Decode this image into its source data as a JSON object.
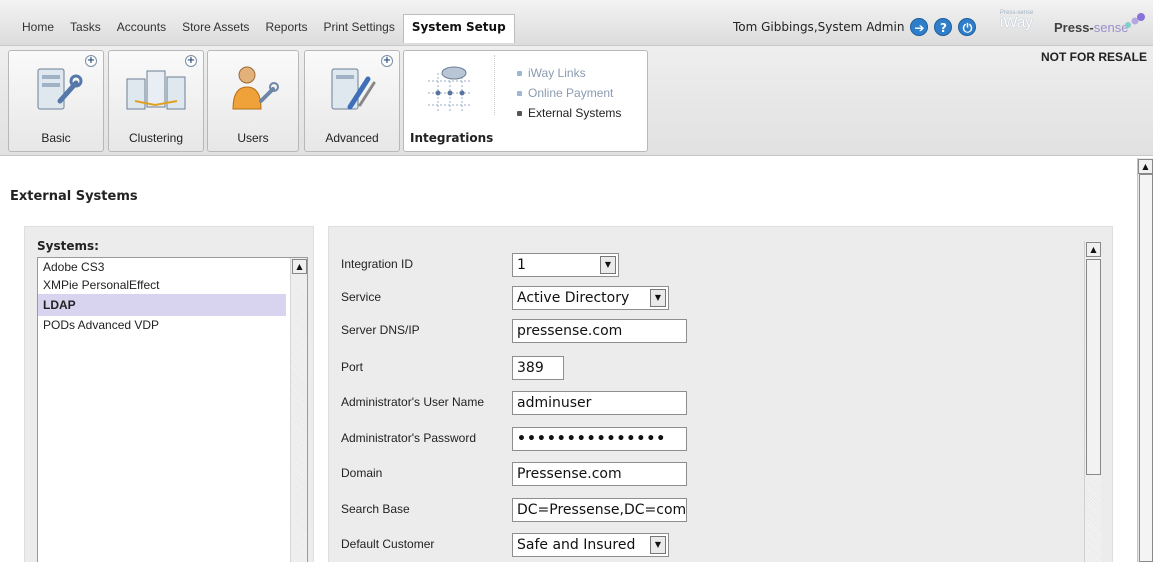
{
  "nav": {
    "items": [
      "Home",
      "Tasks",
      "Accounts",
      "Store Assets",
      "Reports",
      "Print Settings"
    ],
    "active": "System Setup"
  },
  "user": {
    "name": "Tom Gibbings,System Admin",
    "icons": [
      "logout-arrow-icon",
      "help-icon",
      "power-icon"
    ]
  },
  "brand": {
    "iway_small": "Press-sense",
    "iway": "iWay",
    "press": "Press",
    "sense": "sense",
    "not_for_resale": "NOT FOR RESALE",
    "accent_color": "#9c8fcc"
  },
  "ribbon": {
    "buttons": [
      {
        "label": "Basic",
        "icon": "server-wrench-icon"
      },
      {
        "label": "Clustering",
        "icon": "server-cluster-icon"
      },
      {
        "label": "Users",
        "icon": "user-wrench-icon"
      },
      {
        "label": "Advanced",
        "icon": "server-tools-icon"
      }
    ],
    "integrations": {
      "label": "Integrations",
      "icon": "network-plug-icon",
      "links": [
        "iWay Links",
        "Online Payment",
        "External Systems"
      ],
      "current": "External Systems"
    }
  },
  "page": {
    "title": "External Systems"
  },
  "systems": {
    "label": "Systems:",
    "items": [
      "Adobe CS3",
      "XMPie PersonalEffect",
      "LDAP",
      "PODs Advanced VDP"
    ],
    "selected": "LDAP"
  },
  "form": {
    "integration_id": {
      "label": "Integration ID",
      "value": "1"
    },
    "service": {
      "label": "Service",
      "value": "Active Directory"
    },
    "server": {
      "label": "Server DNS/IP",
      "value": "pressense.com"
    },
    "port": {
      "label": "Port",
      "value": "389"
    },
    "admin_user": {
      "label": "Administrator's User Name",
      "value": "adminuser"
    },
    "admin_password": {
      "label": "Administrator's Password",
      "value": "•••••••••••••••"
    },
    "domain": {
      "label": "Domain",
      "value": "Pressense.com"
    },
    "search_base": {
      "label": "Search Base",
      "value": "DC=Pressense,DC=com"
    },
    "default_customer": {
      "label": "Default Customer",
      "value": "Safe and Insured"
    }
  }
}
